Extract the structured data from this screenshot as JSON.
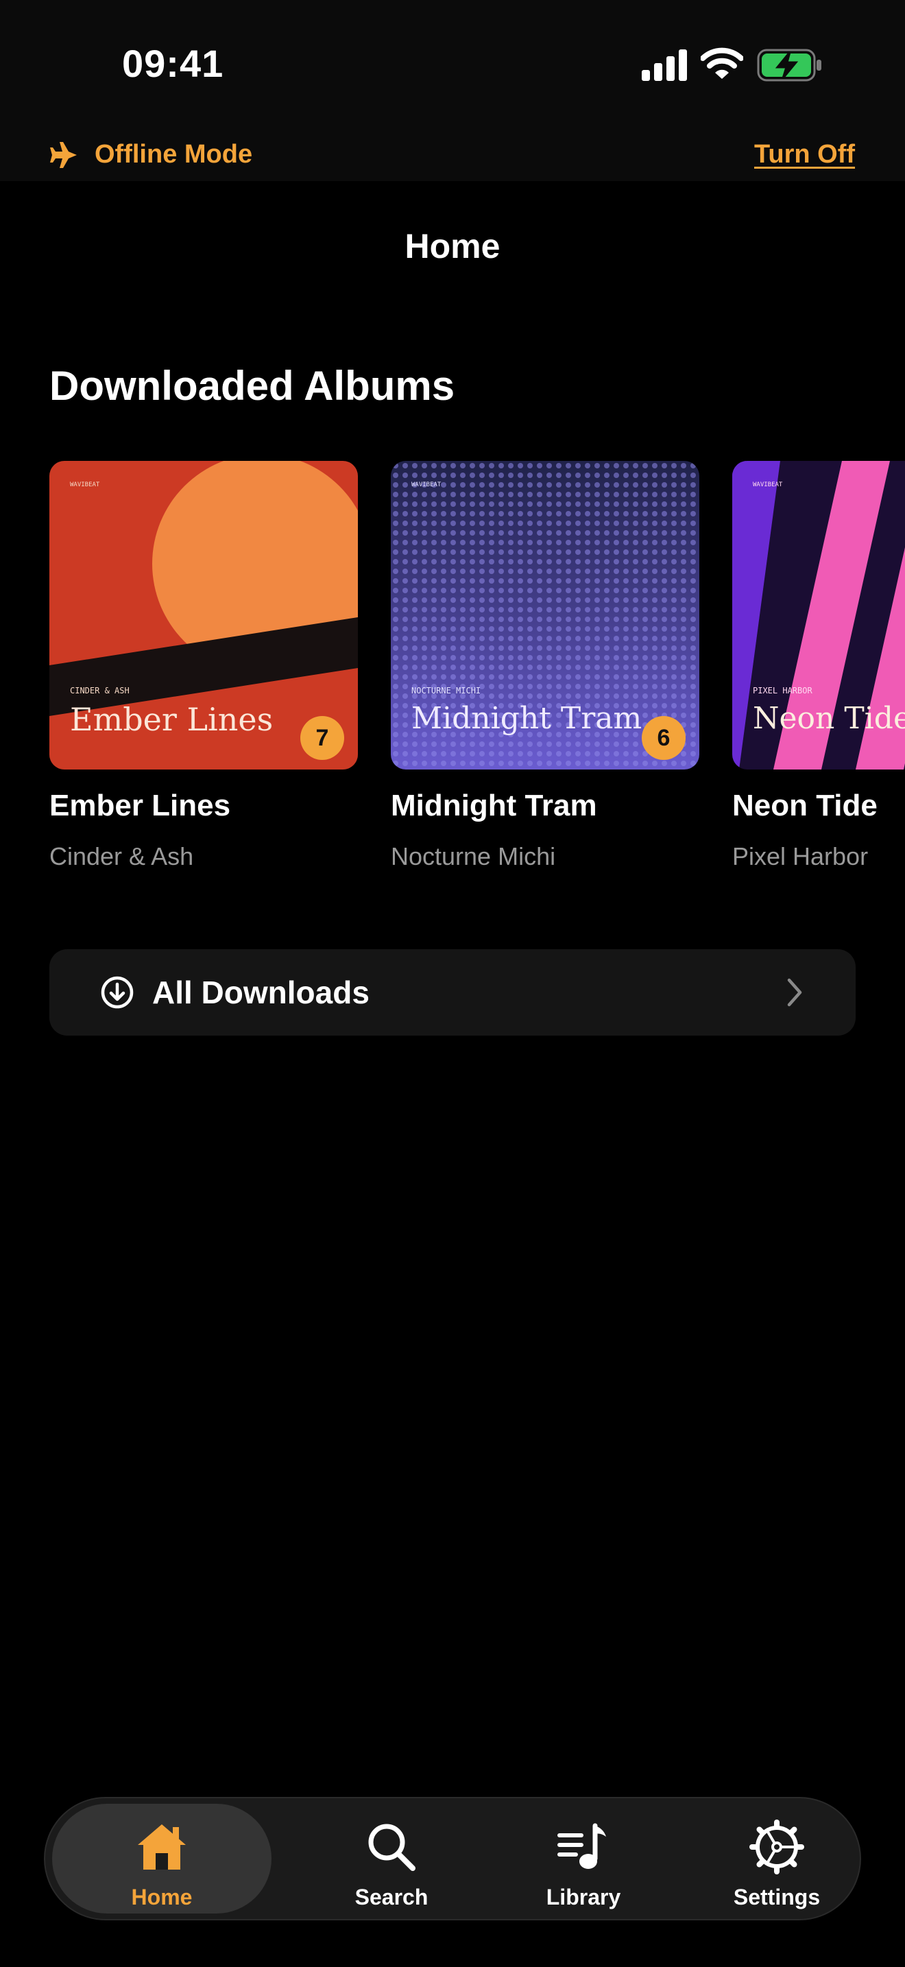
{
  "status_bar": {
    "time": "09:41",
    "icons": [
      "cellular-signal-icon",
      "wifi-icon",
      "battery-charging-icon"
    ],
    "battery_color": "#34c759"
  },
  "offline_banner": {
    "icon": "airplane-icon",
    "label": "Offline Mode",
    "action": "Turn Off",
    "accent_color": "#f4a43a"
  },
  "header": {
    "title": "Home"
  },
  "downloaded_albums": {
    "section_title": "Downloaded Albums",
    "albums": [
      {
        "title": "Ember Lines",
        "artist": "Cinder & Ash",
        "cover_brand": "WAVIBEAT",
        "cover_artist": "CINDER & ASH",
        "cover_title": "Ember Lines",
        "track_count": "7"
      },
      {
        "title": "Midnight Tram",
        "artist": "Nocturne Michi",
        "cover_brand": "WAVIBEAT",
        "cover_artist": "NOCTURNE MICHI",
        "cover_title": "Midnight Tram",
        "track_count": "6"
      },
      {
        "title": "Neon Tide",
        "artist": "Pixel Harbor",
        "cover_brand": "WAVIBEAT",
        "cover_artist": "PIXEL HARBOR",
        "cover_title": "Neon Tide"
      }
    ]
  },
  "all_downloads": {
    "icon": "download-circle-icon",
    "label": "All Downloads"
  },
  "tab_bar": {
    "active": "Home",
    "tabs": [
      {
        "label": "Home",
        "icon": "home-icon"
      },
      {
        "label": "Search",
        "icon": "search-icon"
      },
      {
        "label": "Library",
        "icon": "library-icon"
      },
      {
        "label": "Settings",
        "icon": "settings-icon"
      }
    ]
  }
}
